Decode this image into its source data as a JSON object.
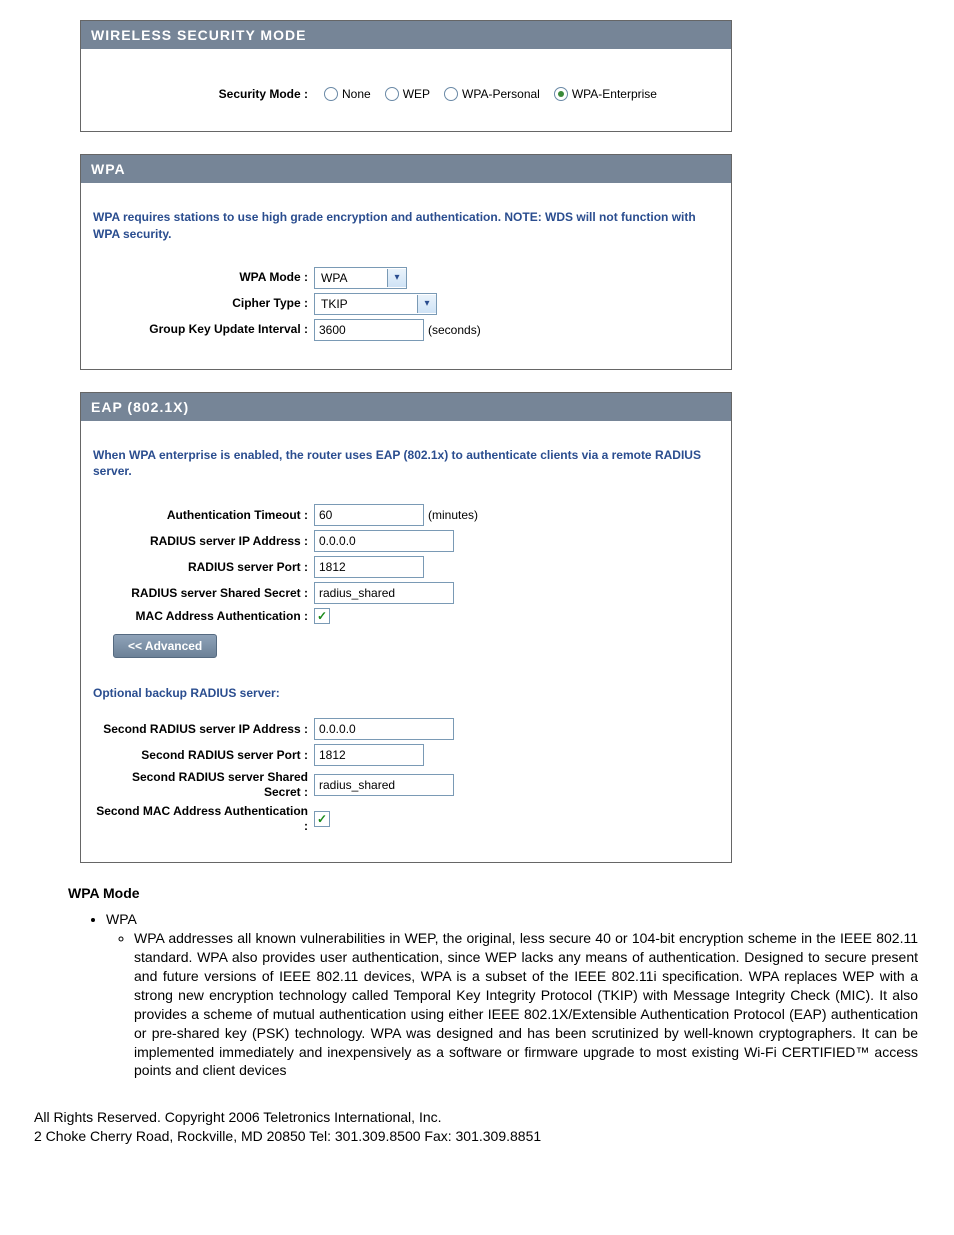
{
  "securityMode": {
    "sectionTitle": "WIRELESS SECURITY MODE",
    "label": "Security Mode :",
    "options": [
      "None",
      "WEP",
      "WPA-Personal",
      "WPA-Enterprise"
    ],
    "selected": "WPA-Enterprise"
  },
  "wpa": {
    "sectionTitle": "WPA",
    "desc": "WPA requires stations to use high grade encryption and authentication. NOTE: WDS will not function with WPA security.",
    "modeLabel": "WPA Mode :",
    "modeValue": "WPA",
    "cipherLabel": "Cipher Type :",
    "cipherValue": "TKIP",
    "groupKeyLabel": "Group Key Update Interval :",
    "groupKeyValue": "3600",
    "groupKeyUnit": "(seconds)"
  },
  "eap": {
    "sectionTitle": "EAP (802.1X)",
    "desc": "When WPA enterprise is enabled, the router uses EAP (802.1x) to authenticate clients via a remote RADIUS server.",
    "authTimeoutLabel": "Authentication Timeout :",
    "authTimeoutValue": "60",
    "authTimeoutUnit": "(minutes)",
    "radiusIpLabel": "RADIUS server IP Address :",
    "radiusIpValue": "0.0.0.0",
    "radiusPortLabel": "RADIUS server Port :",
    "radiusPortValue": "1812",
    "radiusSecretLabel": "RADIUS server Shared Secret :",
    "radiusSecretValue": "radius_shared",
    "macAuthLabel": "MAC Address Authentication :",
    "macAuthChecked": true,
    "advancedBtn": "<< Advanced",
    "backupHeader": "Optional backup RADIUS server:",
    "radius2IpLabel": "Second RADIUS server IP Address :",
    "radius2IpValue": "0.0.0.0",
    "radius2PortLabel": "Second RADIUS server Port :",
    "radius2PortValue": "1812",
    "radius2SecretLabel": "Second RADIUS server Shared Secret :",
    "radius2SecretValue": "radius_shared",
    "macAuth2Label": "Second MAC Address Authentication :",
    "macAuth2Checked": true
  },
  "doc": {
    "heading": "WPA Mode",
    "bullet": "WPA",
    "paragraph": "WPA addresses all known vulnerabilities in WEP, the original, less secure 40 or 104-bit encryption scheme in the IEEE 802.11 standard. WPA also provides user authentication, since WEP lacks any means of authentication. Designed to secure present and future versions of IEEE 802.11 devices, WPA is a subset of the IEEE 802.11i specification. WPA replaces WEP with a strong new encryption technology called Temporal Key Integrity Protocol (TKIP) with Message Integrity Check (MIC). It also provides a scheme of mutual authentication using either IEEE 802.1X/Extensible Authentication Protocol (EAP) authentication or pre-shared key (PSK) technology. WPA was designed and has been scrutinized by well-known cryptographers. It can be implemented immediately and inexpensively as a software or firmware upgrade to most existing Wi-Fi CERTIFIED™ access points and client devices"
  },
  "footer": {
    "line1": "All Rights Reserved. Copyright 2006 Teletronics International, Inc.",
    "line2": "2 Choke Cherry Road, Rockville, MD 20850    Tel: 301.309.8500 Fax: 301.309.8851"
  }
}
